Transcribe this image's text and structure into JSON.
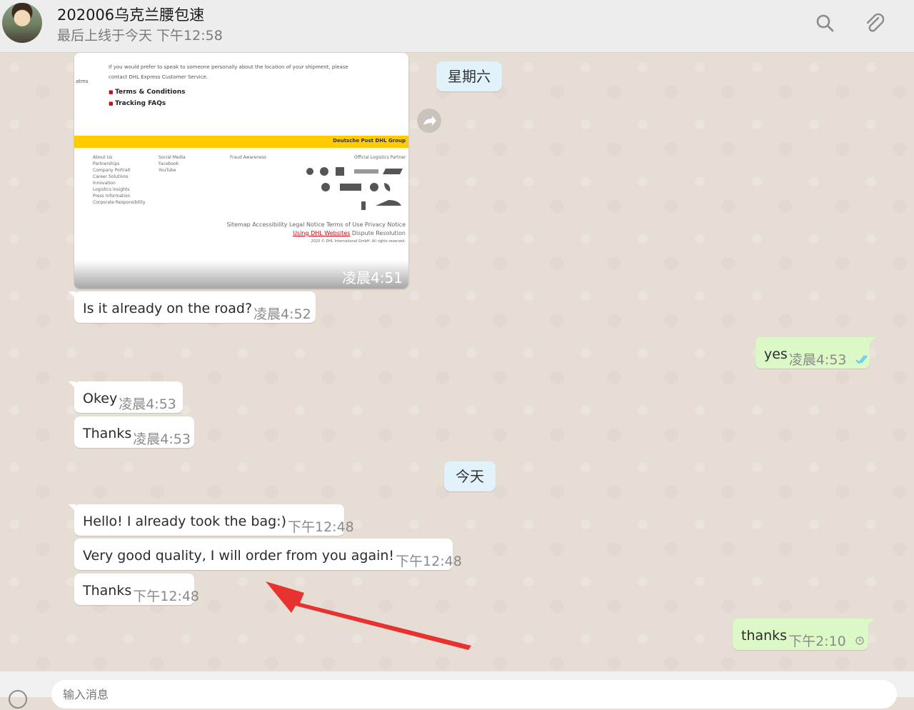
{
  "header": {
    "contact_name": "202006乌克兰腰包速",
    "last_seen": "最后上线于今天 下午12:58"
  },
  "icons": {
    "search": "search-icon",
    "attach": "paperclip-icon",
    "forward": "forward-icon",
    "emoji": "emoji-icon"
  },
  "colors": {
    "incoming_bubble": "#ffffff",
    "outgoing_bubble": "#dcf8c6",
    "day_chip": "#e1f2fb",
    "read_ticks": "#4fc3f7",
    "annotation_arrow": "#e8322f"
  },
  "chat": {
    "date_separators": [
      {
        "label": "星期六"
      },
      {
        "label": "今天"
      }
    ],
    "image_message": {
      "time": "凌晨4:51",
      "doc": {
        "intro": "If you would prefer to speak to someone personally about the location of your shipment, please",
        "contact": "contact DHL Express Customer Service.",
        "side_label": "atms",
        "bullets": [
          "Terms & Conditions",
          "Tracking FAQs"
        ],
        "banner": "Deutsche Post DHL Group",
        "footer_col1": "About Us\nPartnerships\nCompany Portrait\nCareer Solutions\nInnovation\nLogistics Insights\nPress Information\nCorporate Responsibility",
        "footer_col2": "Social Media\nFacebook\nYouTube",
        "footer_col3": "Fraud Awareness",
        "footer_col4": "Official Logistics Partner",
        "footer_links": "Sitemap Accessibility Legal Notice Terms of Use Privacy Notice",
        "footer_link_highlight": "Using DHL Websites",
        "footer_link_tail": "Dispute Resolution",
        "copyright": "2020 © DHL International GmbH. All rights reserved."
      }
    },
    "messages": [
      {
        "text": "Is it  already on the road?",
        "time": "凌晨4:52"
      },
      {
        "text": "yes",
        "time": "凌晨4:53"
      },
      {
        "text": "Okey",
        "time": "凌晨4:53"
      },
      {
        "text": "Thanks",
        "time": "凌晨4:53"
      },
      {
        "text": "Hello! I already took the bag:)",
        "time": "下午12:48"
      },
      {
        "text": "Very good quality, I will order from you again!",
        "time": "下午12:48"
      },
      {
        "text": "Thanks",
        "time": "下午12:48"
      },
      {
        "text": "thanks",
        "time": "下午2:10"
      }
    ]
  },
  "composer": {
    "placeholder": "输入消息"
  }
}
